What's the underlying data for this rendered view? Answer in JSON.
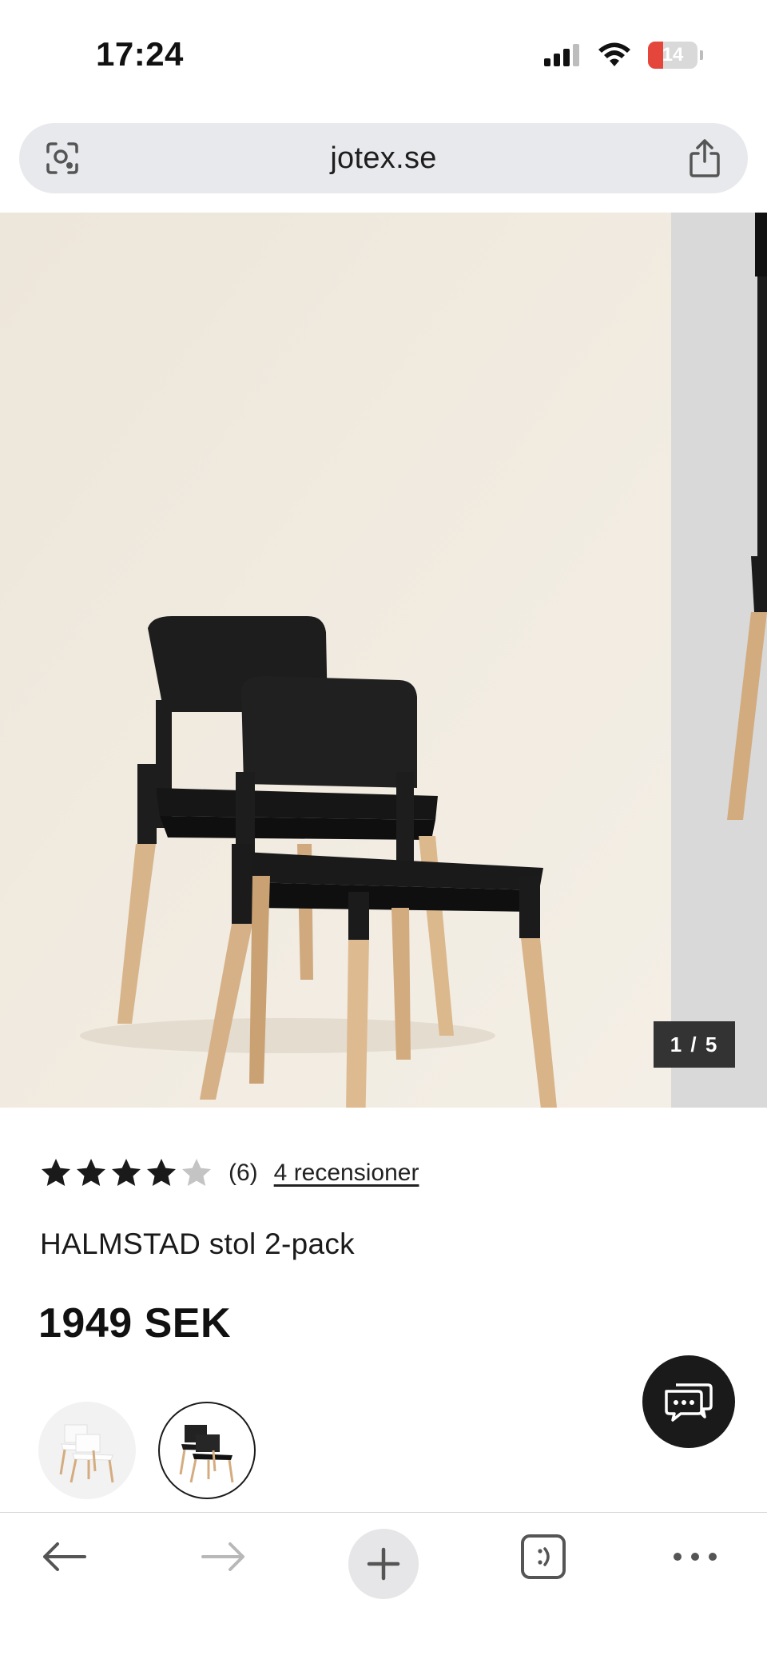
{
  "status_bar": {
    "time": "17:24",
    "battery_level": "14"
  },
  "address_bar": {
    "url": "jotex.se"
  },
  "gallery": {
    "counter": "1 / 5"
  },
  "product": {
    "rating": 4,
    "rating_max": 5,
    "rating_count": "(6)",
    "reviews_link": "4 recensioner",
    "name": "HALMSTAD stol 2-pack",
    "price": "1949 SEK"
  },
  "colors": {
    "accent_dark": "#1a1a1a",
    "battery_low": "#e5463b",
    "address_bg": "#e8e9ec",
    "star_filled": "#1a1a1a",
    "star_empty": "#c4c4c4"
  },
  "icons": {
    "address_left": "visual-lookup-icon",
    "address_right": "share-icon",
    "chat": "chat-bubbles-icon",
    "toolbar": [
      "back-arrow-icon",
      "forward-arrow-icon",
      "plus-icon",
      "tabs-icon",
      "more-icon"
    ]
  }
}
